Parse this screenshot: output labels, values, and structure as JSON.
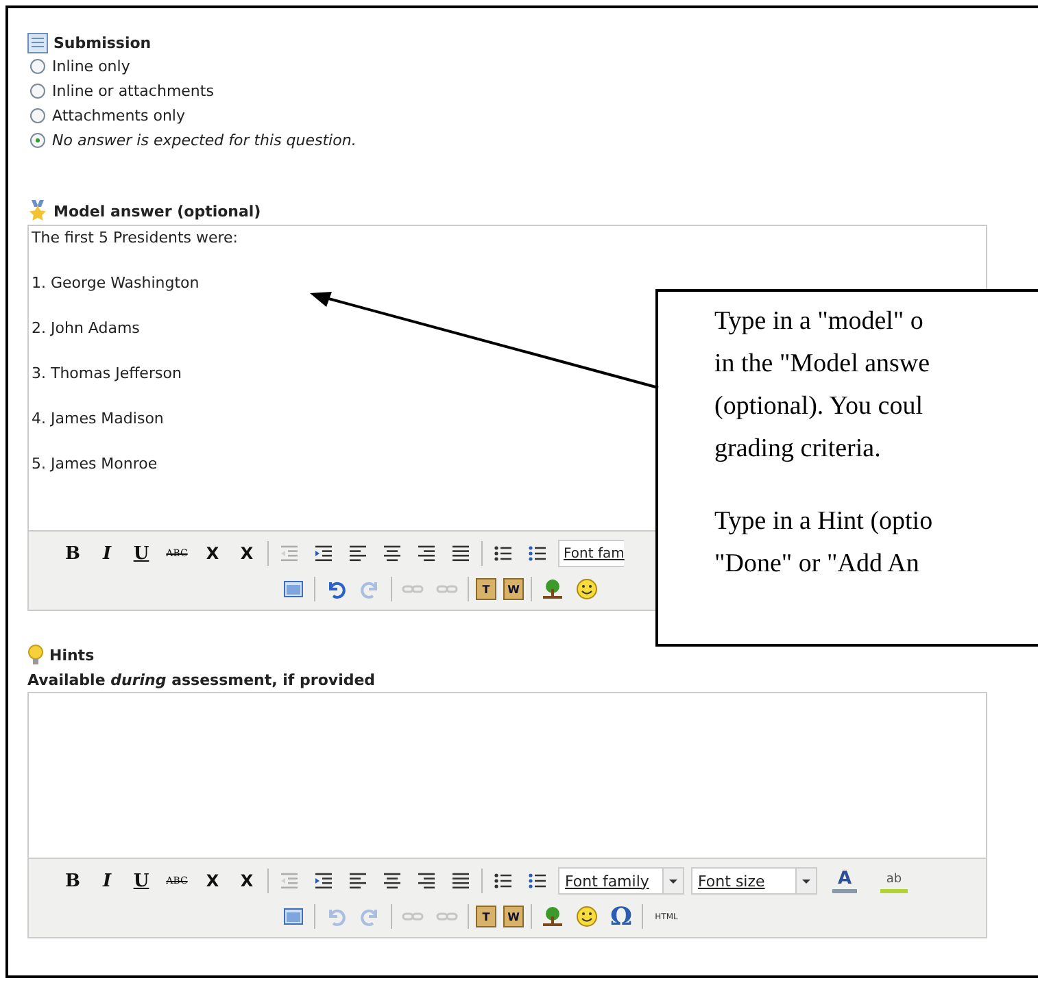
{
  "submission": {
    "title": "Submission",
    "options": [
      {
        "label": "Inline only",
        "kind": "plain",
        "selected": false
      },
      {
        "label": "Inline or attachments",
        "kind": "plain",
        "selected": false
      },
      {
        "label": "Attachments only",
        "kind": "plain",
        "selected": false
      },
      {
        "label": "No answer is expected for this question.",
        "kind": "note",
        "selected": true
      }
    ]
  },
  "model_answer": {
    "title": "Model answer (optional)",
    "paragraphs": [
      "The first 5 Presidents were:",
      "1. George Washington",
      "2. John Adams",
      "3. Thomas Jefferson",
      "4. James Madison",
      "5. James Monroe"
    ],
    "toolbar": [
      [
        {
          "kind": "bold",
          "label": "B"
        },
        {
          "kind": "italic",
          "label": "I"
        },
        {
          "kind": "underline",
          "label": "U"
        },
        {
          "kind": "strike",
          "label": "ABC"
        },
        {
          "kind": "sub",
          "label": "X"
        },
        {
          "kind": "sup",
          "label": "X"
        },
        {
          "kind": "sep"
        },
        {
          "kind": "outdent",
          "disabled": true
        },
        {
          "kind": "indent",
          "disabled": false
        },
        {
          "kind": "align-left"
        },
        {
          "kind": "align-center"
        },
        {
          "kind": "align-right"
        },
        {
          "kind": "justify"
        },
        {
          "kind": "sep"
        },
        {
          "kind": "bullets"
        },
        {
          "kind": "numbers"
        },
        {
          "kind": "select",
          "label": "Font fam"
        }
      ],
      [
        {
          "kind": "image"
        },
        {
          "kind": "sep"
        },
        {
          "kind": "undo",
          "disabled": false
        },
        {
          "kind": "redo",
          "disabled": true
        },
        {
          "kind": "sep"
        },
        {
          "kind": "link",
          "disabled": true
        },
        {
          "kind": "unlink",
          "disabled": true
        },
        {
          "kind": "sep"
        },
        {
          "kind": "paste-text",
          "label": "T"
        },
        {
          "kind": "paste-word",
          "label": "W"
        },
        {
          "kind": "sep"
        },
        {
          "kind": "picture"
        },
        {
          "kind": "smiley"
        }
      ]
    ]
  },
  "hints": {
    "title": "Hints",
    "subtitle": "Available *during* assessment, if provided",
    "toolbar": [
      [
        {
          "kind": "bold",
          "label": "B"
        },
        {
          "kind": "italic",
          "label": "I"
        },
        {
          "kind": "underline",
          "label": "U"
        },
        {
          "kind": "strike",
          "label": "ABC"
        },
        {
          "kind": "sub",
          "label": "X"
        },
        {
          "kind": "sup",
          "label": "X"
        },
        {
          "kind": "sep"
        },
        {
          "kind": "outdent",
          "disabled": true
        },
        {
          "kind": "indent",
          "disabled": false
        },
        {
          "kind": "align-left"
        },
        {
          "kind": "align-center"
        },
        {
          "kind": "align-right"
        },
        {
          "kind": "justify"
        },
        {
          "kind": "sep"
        },
        {
          "kind": "bullets"
        },
        {
          "kind": "numbers"
        },
        {
          "kind": "select",
          "label": "Font family"
        },
        {
          "kind": "select",
          "label": "Font size"
        },
        {
          "kind": "color",
          "label": "A"
        },
        {
          "kind": "highlight",
          "label": "ab"
        }
      ],
      [
        {
          "kind": "image"
        },
        {
          "kind": "sep"
        },
        {
          "kind": "undo",
          "disabled": true
        },
        {
          "kind": "redo",
          "disabled": true
        },
        {
          "kind": "sep"
        },
        {
          "kind": "link",
          "disabled": true
        },
        {
          "kind": "unlink",
          "disabled": true
        },
        {
          "kind": "sep"
        },
        {
          "kind": "paste-text",
          "label": "T"
        },
        {
          "kind": "paste-word",
          "label": "W"
        },
        {
          "kind": "sep"
        },
        {
          "kind": "picture"
        },
        {
          "kind": "smiley"
        },
        {
          "kind": "omega",
          "label": "Ω"
        },
        {
          "kind": "sep"
        },
        {
          "kind": "html",
          "label": "HTML"
        }
      ]
    ]
  },
  "callout": {
    "paragraphs": [
      [
        "Type in a \"model\" o",
        "in the \"Model answe",
        "(optional). You coul",
        "grading criteria."
      ],
      [
        "Type in a Hint (optio",
        "\"Done\" or \"Add An"
      ]
    ]
  }
}
